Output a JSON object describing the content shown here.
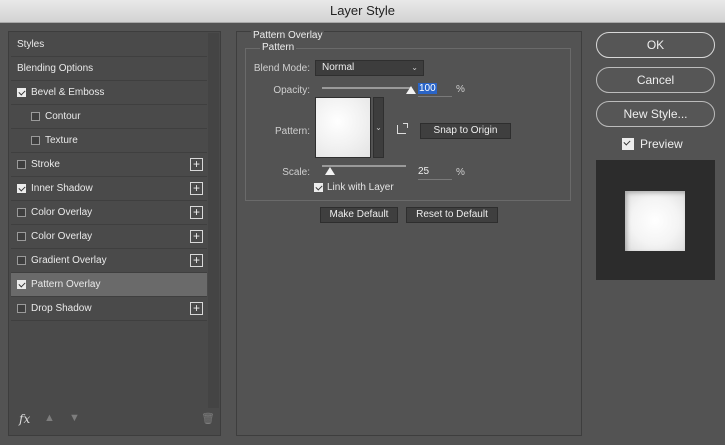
{
  "window": {
    "title": "Layer Style"
  },
  "styles_list": [
    {
      "label": "Styles",
      "checkbox": false,
      "checked": false,
      "indent": 0,
      "plus": false,
      "selected": false
    },
    {
      "label": "Blending Options",
      "checkbox": false,
      "checked": false,
      "indent": 0,
      "plus": false,
      "selected": false
    },
    {
      "label": "Bevel & Emboss",
      "checkbox": true,
      "checked": true,
      "indent": 0,
      "plus": false,
      "selected": false
    },
    {
      "label": "Contour",
      "checkbox": true,
      "checked": false,
      "indent": 1,
      "plus": false,
      "selected": false
    },
    {
      "label": "Texture",
      "checkbox": true,
      "checked": false,
      "indent": 1,
      "plus": false,
      "selected": false
    },
    {
      "label": "Stroke",
      "checkbox": true,
      "checked": false,
      "indent": 0,
      "plus": true,
      "selected": false
    },
    {
      "label": "Inner Shadow",
      "checkbox": true,
      "checked": true,
      "indent": 0,
      "plus": true,
      "selected": false
    },
    {
      "label": "Color Overlay",
      "checkbox": true,
      "checked": false,
      "indent": 0,
      "plus": true,
      "selected": false
    },
    {
      "label": "Color Overlay",
      "checkbox": true,
      "checked": false,
      "indent": 0,
      "plus": true,
      "selected": false
    },
    {
      "label": "Gradient Overlay",
      "checkbox": true,
      "checked": false,
      "indent": 0,
      "plus": true,
      "selected": false
    },
    {
      "label": "Pattern Overlay",
      "checkbox": true,
      "checked": true,
      "indent": 0,
      "plus": false,
      "selected": true
    },
    {
      "label": "Drop Shadow",
      "checkbox": true,
      "checked": false,
      "indent": 0,
      "plus": true,
      "selected": false
    }
  ],
  "footer": {
    "fx_label": "fx"
  },
  "panel": {
    "title": "Pattern Overlay",
    "group_title": "Pattern",
    "blend_mode_label": "Blend Mode:",
    "blend_mode_value": "Normal",
    "opacity_label": "Opacity:",
    "opacity_value": "100",
    "opacity_unit": "%",
    "opacity_level": 1.0,
    "pattern_label": "Pattern:",
    "snap_button": "Snap to Origin",
    "scale_label": "Scale:",
    "scale_value": "25",
    "scale_unit": "%",
    "scale_level": 0.0,
    "link_label": "Link with Layer",
    "link_checked": true,
    "make_default": "Make Default",
    "reset_default": "Reset to Default"
  },
  "actions": {
    "ok": "OK",
    "cancel": "Cancel",
    "new_style": "New Style...",
    "preview_label": "Preview",
    "preview_checked": true
  }
}
